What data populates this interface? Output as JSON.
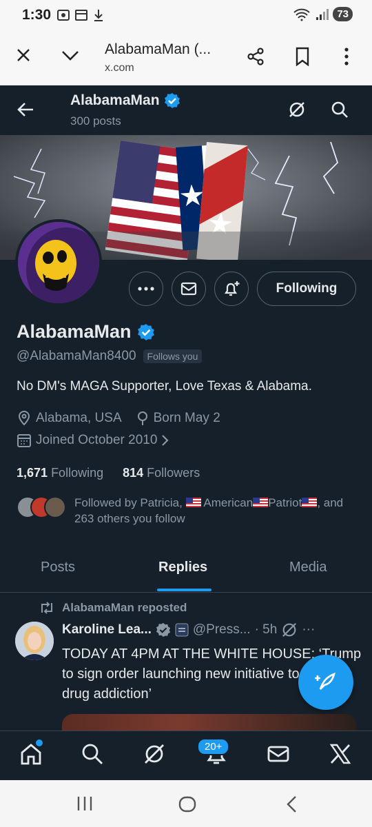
{
  "status_bar": {
    "time": "1:30",
    "battery": "73"
  },
  "browser": {
    "title": "AlabamaMan (...",
    "url": "x.com"
  },
  "header": {
    "name": "AlabamaMan",
    "posts": "300 posts"
  },
  "profile": {
    "display_name": "AlabamaMan",
    "handle": "@AlabamaMan8400",
    "follows_you": "Follows you",
    "bio": "No DM's MAGA Supporter, Love Texas & Alabama.",
    "location": "Alabama, USA",
    "birthday": "Born May 2",
    "joined": "Joined October 2010",
    "following_count": "1,671",
    "following_label": "Following",
    "followers_count": "814",
    "followers_label": "Followers",
    "followed_by_prefix": "Followed by Patricia,",
    "followed_by_name": "American",
    "followed_by_name2": "Patriot",
    "followed_by_suffix": ", and 263 others you follow",
    "following_button": "Following"
  },
  "tabs": [
    {
      "label": "Posts"
    },
    {
      "label": "Replies"
    },
    {
      "label": "Media"
    }
  ],
  "tweet": {
    "repost_label": "AlabamaMan reposted",
    "author_name": "Karoline Lea...",
    "author_handle": "@Press...",
    "time": "· 5h",
    "more": "···",
    "text": "TODAY AT 4PM AT THE WHITE HOUSE: ‘Trump to sign order launching new initiative to address drug addiction’"
  },
  "bottom_nav": {
    "notification_badge": "20+"
  },
  "colors": {
    "accent": "#1d9bf0",
    "background": "#15202b",
    "secondary_text": "#8b98a5",
    "border": "#38444d"
  },
  "icons": {
    "status": [
      "screenshot-icon",
      "calendar-icon",
      "download-icon",
      "wifi-icon",
      "signal-icon",
      "battery-icon"
    ],
    "browser": [
      "close-icon",
      "chevron-down-icon",
      "share-icon",
      "bookmark-icon",
      "more-vert-icon"
    ],
    "header": [
      "back-arrow-icon",
      "verified-icon",
      "grok-icon",
      "search-icon"
    ],
    "profile": [
      "more-icon",
      "message-icon",
      "subscribe-bell-icon",
      "location-icon",
      "birthday-icon",
      "calendar-icon",
      "chevron-right-icon"
    ],
    "nav": [
      "home-icon",
      "search-icon",
      "grok-icon",
      "notifications-icon",
      "messages-icon",
      "x-logo-icon"
    ]
  }
}
